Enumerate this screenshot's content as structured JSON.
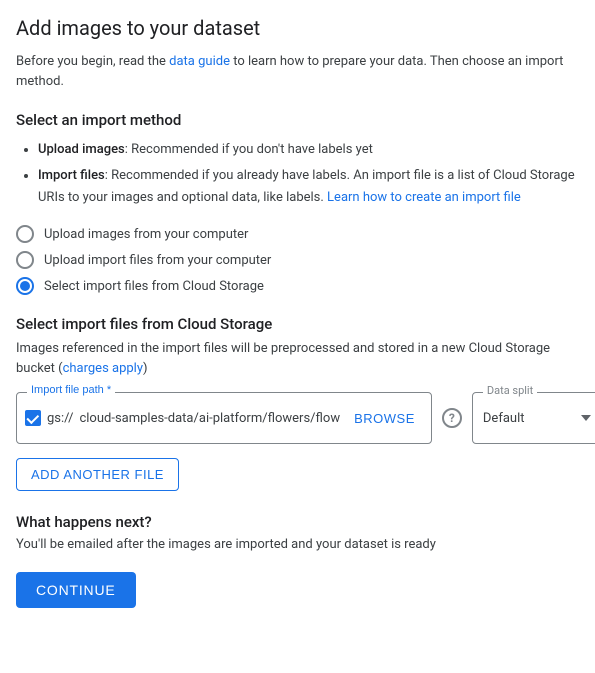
{
  "page": {
    "title": "Add images to your dataset",
    "intro_text": "Before you begin, read the ",
    "intro_link_text": "data guide",
    "intro_after": " to learn how to prepare your data. Then choose an import method.",
    "section1_title": "Select an import method",
    "bullets": [
      {
        "term": "Upload images",
        "text": ": Recommended if you don't have labels yet"
      },
      {
        "term": "Import files",
        "text": ": Recommended if you already have labels. An import file is a list of Cloud Storage URIs to your images and optional data, like labels. ",
        "link_text": "Learn how to create an import file",
        "link_href": "#"
      }
    ],
    "radio_options": [
      {
        "id": "radio1",
        "label": "Upload images from your computer",
        "checked": false
      },
      {
        "id": "radio2",
        "label": "Upload import files from your computer",
        "checked": false
      },
      {
        "id": "radio3",
        "label": "Select import files from Cloud Storage",
        "checked": true
      }
    ],
    "section2_title": "Select import files from Cloud Storage",
    "section2_desc": "Images referenced in the import files will be preprocessed and stored in a new Cloud Storage bucket (",
    "section2_link": "charges apply",
    "section2_desc2": ")",
    "file_path_label": "Import file path *",
    "file_path_prefix": "gs://",
    "file_path_value": "cloud-samples-data/ai-platform/flowers/flow",
    "browse_label": "BROWSE",
    "data_split_label": "Data split",
    "data_split_value": "Default",
    "add_file_label": "ADD ANOTHER FILE",
    "what_next_title": "What happens next?",
    "what_next_desc": "You'll be emailed after the images are imported and your dataset is ready",
    "continue_label": "CONTINUE"
  }
}
